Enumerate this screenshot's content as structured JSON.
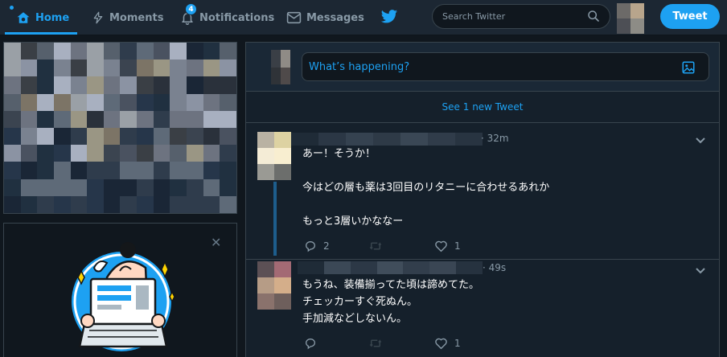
{
  "nav": {
    "home_label": "Home",
    "moments_label": "Moments",
    "notifications_label": "Notifications",
    "notifications_count": "4",
    "messages_label": "Messages"
  },
  "search": {
    "placeholder": "Search Twitter"
  },
  "tweet_button_label": "Tweet",
  "compose": {
    "placeholder": "What’s happening?"
  },
  "new_tweets_label": "See 1 new Tweet",
  "tweets": [
    {
      "time": "· 32m",
      "text": "あー！そうか！\n\n今はどの層も薬は3回目のリタニーに合わせるあれか\n\nもっと3層いかななー",
      "replies": "2",
      "retweets": "",
      "likes": "1"
    },
    {
      "time": "· 49s",
      "text": "もうね、装備揃ってた頃は諦めてた。\nチェッカーすぐ死ぬん。\n手加減などしないん。",
      "replies": "",
      "retweets": "",
      "likes": "1"
    }
  ],
  "colors": {
    "accent": "#1da1f2",
    "topbar_bg": "#1c2733",
    "page_bg": "#10171e",
    "card_bg": "#15202b",
    "border": "#38444d",
    "muted_text": "#8899a6"
  },
  "icons": [
    "home-icon",
    "moments-icon",
    "notifications-icon",
    "messages-icon",
    "twitter-bird-icon",
    "search-icon",
    "image-icon",
    "close-icon",
    "chevron-down-icon",
    "reply-icon",
    "retweet-icon",
    "like-icon"
  ]
}
